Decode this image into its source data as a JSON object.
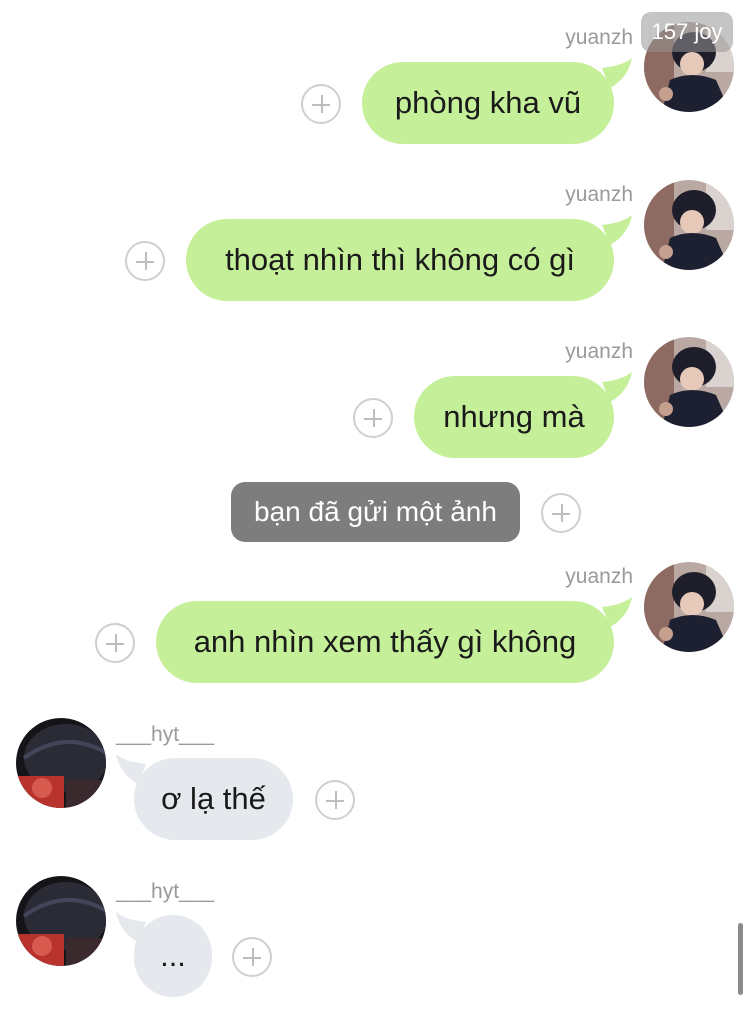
{
  "watermark": "157 joy",
  "messages": [
    {
      "sender": "yuanzh",
      "text": "phòng kha vũ"
    },
    {
      "sender": "yuanzh",
      "text": "thoạt nhìn thì không có gì"
    },
    {
      "sender": "yuanzh",
      "text": "nhưng mà"
    },
    {
      "notice": "bạn đã gửi một ảnh"
    },
    {
      "sender": "yuanzh",
      "text": "anh nhìn xem thấy gì không"
    },
    {
      "sender": "___hyt___",
      "text": "ơ lạ thế"
    },
    {
      "sender": "___hyt___",
      "text": "..."
    }
  ],
  "colors": {
    "outgoing_bubble": "#c6ef9a",
    "incoming_bubble": "#e5e8ec",
    "notice_bubble": "#7d7d7d",
    "sender_text": "#9a9a9a"
  },
  "icons": [
    "plus-circle-icon",
    "avatar-yuanzh",
    "avatar-hyt"
  ]
}
